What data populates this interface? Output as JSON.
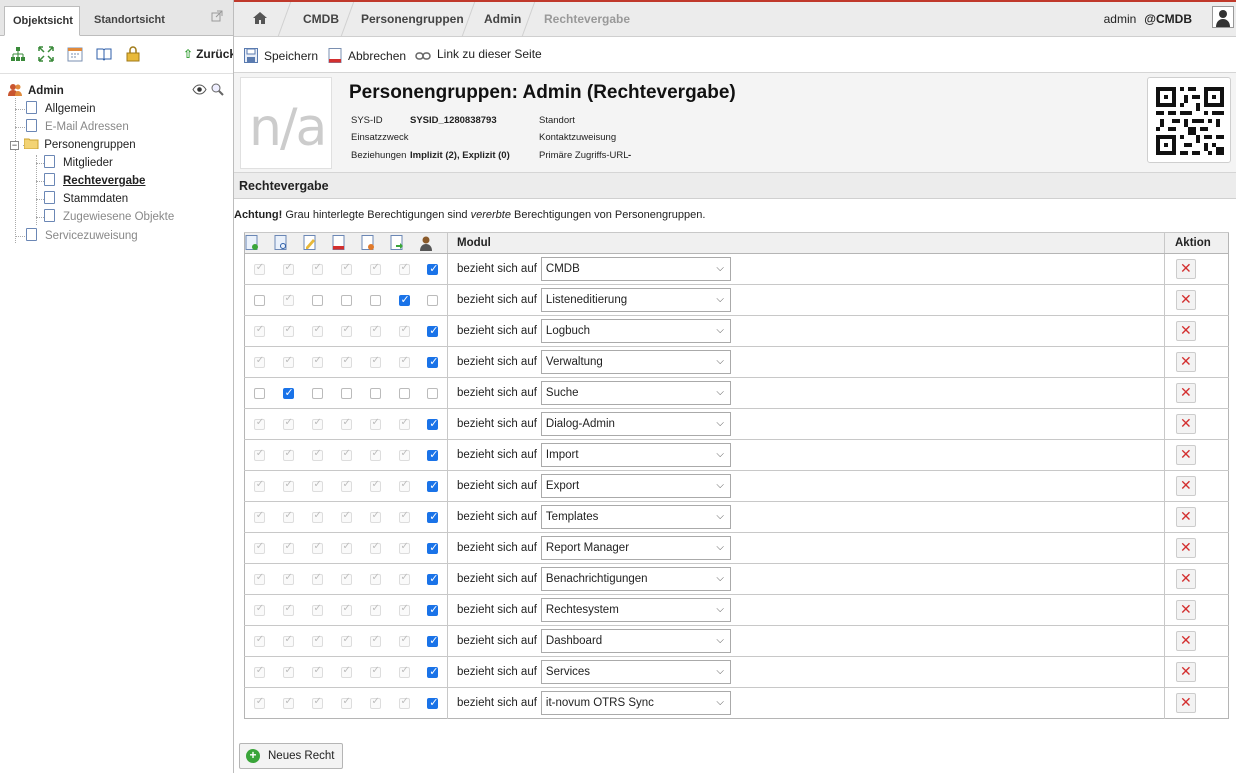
{
  "left_panel": {
    "tabs": [
      "Objektsicht",
      "Standortsicht"
    ],
    "back_label": "Zurück",
    "tree": {
      "root": "Admin",
      "items": [
        {
          "label": "Allgemein",
          "muted": false
        },
        {
          "label": "E-Mail Adressen",
          "muted": true
        },
        {
          "label": "Personengruppen",
          "muted": false
        },
        {
          "label": "Mitglieder",
          "muted": false
        },
        {
          "label": "Rechtevergabe",
          "muted": false
        },
        {
          "label": "Stammdaten",
          "muted": false
        },
        {
          "label": "Zugewiesene Objekte",
          "muted": true
        },
        {
          "label": "Servicezuweisung",
          "muted": true
        }
      ]
    }
  },
  "breadcrumb": [
    "CMDB",
    "Personengruppen",
    "Admin",
    "Rechtevergabe"
  ],
  "user": {
    "name": "admin",
    "tenant": "@CMDB"
  },
  "actions": {
    "save": "Speichern",
    "cancel": "Abbrechen",
    "link": "Link zu dieser Seite"
  },
  "object": {
    "image_placeholder": "n/a",
    "title": "Personengruppen: Admin (Rechtevergabe)",
    "meta": {
      "sysid_label": "SYS-ID",
      "sysid_value": "SYSID_1280838793",
      "einsatz_label": "Einsatzzweck",
      "beziehungen_label": "Beziehungen",
      "beziehungen_value": "Implizit (2), Explizit (0)",
      "standort_label": "Standort",
      "kontakt_label": "Kontaktzuweisung",
      "url_label": "Primäre Zugriffs-URL",
      "url_value": "-"
    }
  },
  "section": {
    "title": "Rechtevergabe",
    "notice_bold": "Achtung!",
    "notice_text_1": " Grau hinterlegte Berechtigungen sind ",
    "notice_italic": "vererbte",
    "notice_text_2": " Berechtigungen von Personengruppen."
  },
  "table": {
    "col_modul": "Modul",
    "col_aktion": "Aktion",
    "relation_text": "bezieht sich auf",
    "header_icons": [
      "create-icon",
      "view-icon",
      "edit-icon",
      "delete-icon",
      "archive-icon",
      "execute-icon",
      "supervisor-icon"
    ],
    "rows": [
      {
        "module": "CMDB",
        "perms": [
          "d",
          "d",
          "d",
          "d",
          "d",
          "d",
          "c"
        ]
      },
      {
        "module": "Listeneditierung",
        "perms": [
          "u",
          "d",
          "u",
          "u",
          "u",
          "c",
          "u"
        ]
      },
      {
        "module": "Logbuch",
        "perms": [
          "d",
          "d",
          "d",
          "d",
          "d",
          "d",
          "c"
        ]
      },
      {
        "module": "Verwaltung",
        "perms": [
          "d",
          "d",
          "d",
          "d",
          "d",
          "d",
          "c"
        ]
      },
      {
        "module": "Suche",
        "perms": [
          "u",
          "c",
          "u",
          "u",
          "u",
          "u",
          "u"
        ]
      },
      {
        "module": "Dialog-Admin",
        "perms": [
          "d",
          "d",
          "d",
          "d",
          "d",
          "d",
          "c"
        ]
      },
      {
        "module": "Import",
        "perms": [
          "d",
          "d",
          "d",
          "d",
          "d",
          "d",
          "c"
        ]
      },
      {
        "module": "Export",
        "perms": [
          "d",
          "d",
          "d",
          "d",
          "d",
          "d",
          "c"
        ]
      },
      {
        "module": "Templates",
        "perms": [
          "d",
          "d",
          "d",
          "d",
          "d",
          "d",
          "c"
        ]
      },
      {
        "module": "Report Manager",
        "perms": [
          "d",
          "d",
          "d",
          "d",
          "d",
          "d",
          "c"
        ]
      },
      {
        "module": "Benachrichtigungen",
        "perms": [
          "d",
          "d",
          "d",
          "d",
          "d",
          "d",
          "c"
        ]
      },
      {
        "module": "Rechtesystem",
        "perms": [
          "d",
          "d",
          "d",
          "d",
          "d",
          "d",
          "c"
        ]
      },
      {
        "module": "Dashboard",
        "perms": [
          "d",
          "d",
          "d",
          "d",
          "d",
          "d",
          "c"
        ]
      },
      {
        "module": "Services",
        "perms": [
          "d",
          "d",
          "d",
          "d",
          "d",
          "d",
          "c"
        ]
      },
      {
        "module": "it-novum OTRS Sync",
        "perms": [
          "d",
          "d",
          "d",
          "d",
          "d",
          "d",
          "c"
        ]
      }
    ]
  },
  "new_right_label": "Neues Recht",
  "colors": {
    "accent": "#1a73e8",
    "danger": "#d32f2f",
    "topline": "#c0392b",
    "green": "#3aa53a"
  }
}
